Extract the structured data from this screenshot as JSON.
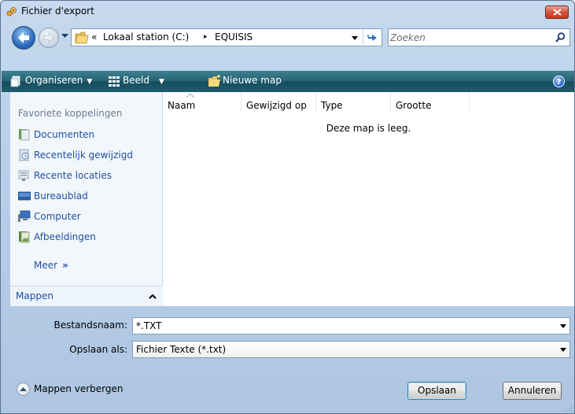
{
  "window": {
    "title": "Fichier d'export"
  },
  "address": {
    "chevron": "«",
    "crumbs": [
      "Lokaal station (C:)",
      "EQUISIS"
    ],
    "separator": "▸"
  },
  "search": {
    "placeholder": "Zoeken"
  },
  "toolbar": {
    "organize": "Organiseren",
    "view": "Beeld",
    "new_folder": "Nieuwe map",
    "help": "?"
  },
  "nav": {
    "heading": "Favoriete koppelingen",
    "items": [
      {
        "label": "Documenten",
        "icon": "documents-icon"
      },
      {
        "label": "Recentelijk gewijzigd",
        "icon": "recently-changed-icon"
      },
      {
        "label": "Recente locaties",
        "icon": "recent-places-icon"
      },
      {
        "label": "Bureaublad",
        "icon": "desktop-icon"
      },
      {
        "label": "Computer",
        "icon": "computer-icon"
      },
      {
        "label": "Afbeeldingen",
        "icon": "pictures-icon"
      }
    ],
    "more": "Meer",
    "more_arrow": "»",
    "folders": "Mappen"
  },
  "files": {
    "columns": [
      "Naam",
      "Gewijzigd op",
      "Type",
      "Grootte"
    ],
    "empty_message": "Deze map is leeg."
  },
  "form": {
    "filename_label": "Bestandsnaam:",
    "filename_value": "*.TXT",
    "type_label": "Opslaan als:",
    "type_value": "Fichier Texte (*.txt)"
  },
  "footer": {
    "hide_folders": "Mappen verbergen",
    "save": "Opslaan",
    "cancel": "Annuleren"
  },
  "colors": {
    "link": "#1e4fa3",
    "cmdbar": "#236272",
    "close_button": "#d2563f"
  }
}
